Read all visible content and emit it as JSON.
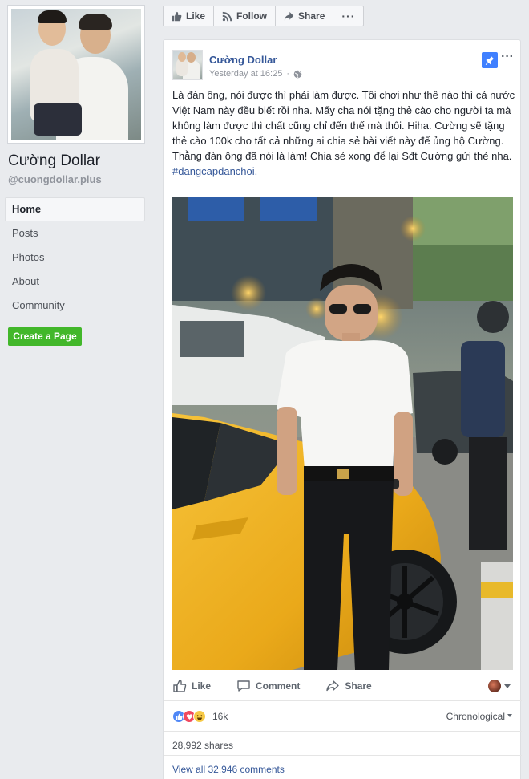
{
  "page": {
    "name": "Cường Dollar",
    "handle": "@cuongdollar.plus"
  },
  "nav": {
    "items": [
      {
        "label": "Home",
        "active": true
      },
      {
        "label": "Posts",
        "active": false
      },
      {
        "label": "Photos",
        "active": false
      },
      {
        "label": "About",
        "active": false
      },
      {
        "label": "Community",
        "active": false
      }
    ]
  },
  "create_page_label": "Create a Page",
  "action_bar": {
    "like": "Like",
    "follow": "Follow",
    "share": "Share",
    "more": "···"
  },
  "post": {
    "author": "Cường Dollar",
    "timestamp": "Yesterday at 16:25",
    "more": "···",
    "text": "Là đàn ông, nói được thì phải làm được. Tôi chơi như thế nào thì cả nước Việt Nam này đều biết rồi nha. Mấy cha nói tặng thẻ cào cho người ta mà không làm được thì chất cũng chỉ đến thế mà thôi. Hiha. Cường sẽ tặng thẻ cào 100k cho tất cả những ai chia sẻ bài viết này để ủng hộ Cường. Thằng đàn ông đã nói là làm! Chia sẻ xong để lại Sđt Cường gửi thẻ nha.",
    "hashtag": "#dangcapdanchoi.",
    "actions": {
      "like": "Like",
      "comment": "Comment",
      "share": "Share"
    },
    "reactions": {
      "types": [
        "like-icon",
        "love-icon",
        "haha-icon"
      ],
      "count": "16k"
    },
    "sort_label": "Chronological",
    "shares": "28,992 shares",
    "view_comments": "View all 32,946 comments"
  },
  "colors": {
    "link_blue": "#365899",
    "create_green": "#42b72a",
    "pin_blue": "#4080ff",
    "background": "#e9ebee"
  }
}
